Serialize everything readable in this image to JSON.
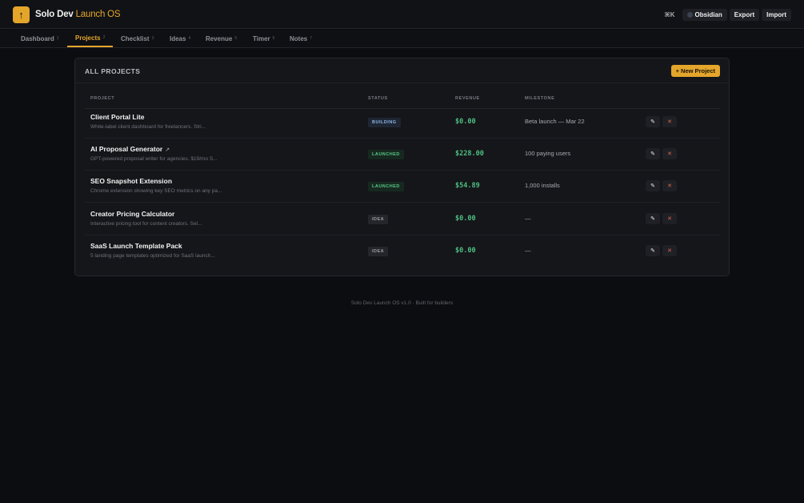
{
  "header": {
    "logo_glyph": "↑",
    "brand_primary": "Solo Dev",
    "brand_accent": "Launch OS",
    "shortcut": "⌘K",
    "theme_button": "Obsidian",
    "export_button": "Export",
    "import_button": "Import"
  },
  "nav": {
    "tabs": [
      {
        "label": "Dashboard",
        "key": "1"
      },
      {
        "label": "Projects",
        "key": "2"
      },
      {
        "label": "Checklist",
        "key": "3"
      },
      {
        "label": "Ideas",
        "key": "4"
      },
      {
        "label": "Revenue",
        "key": "5"
      },
      {
        "label": "Timer",
        "key": "6"
      },
      {
        "label": "Notes",
        "key": "7"
      }
    ],
    "active": "Projects"
  },
  "panel": {
    "title": "ALL PROJECTS",
    "new_button": "+ New Project",
    "columns": [
      "PROJECT",
      "STATUS",
      "REVENUE",
      "MILESTONE"
    ],
    "rows": [
      {
        "name": "Client Portal Lite",
        "external": "",
        "desc": "White-label client dashboard for freelancers. Stri...",
        "status": "BUILDING",
        "revenue": "$0.00",
        "milestone": "Beta launch — Mar 22"
      },
      {
        "name": "AI Proposal Generator",
        "external": "↗",
        "desc": "GPT-powered proposal writer for agencies. $19/mo S...",
        "status": "LAUNCHED",
        "revenue": "$228.00",
        "milestone": "100 paying users"
      },
      {
        "name": "SEO Snapshot Extension",
        "external": "",
        "desc": "Chrome extension showing key SEO metrics on any pa...",
        "status": "LAUNCHED",
        "revenue": "$54.89",
        "milestone": "1,000 installs"
      },
      {
        "name": "Creator Pricing Calculator",
        "external": "",
        "desc": "Interactive pricing tool for content creators. Sel...",
        "status": "IDEA",
        "revenue": "$0.00",
        "milestone": "—"
      },
      {
        "name": "SaaS Launch Template Pack",
        "external": "",
        "desc": "5 landing page templates optimized for SaaS launch...",
        "status": "IDEA",
        "revenue": "$0.00",
        "milestone": "—"
      }
    ],
    "edit_glyph": "✎",
    "delete_glyph": "✕"
  },
  "footer": {
    "text": "Solo Dev Launch OS v1.0 · Built for builders"
  },
  "colors": {
    "accent": "#e4a52b",
    "success": "#4fbf80",
    "danger": "#e0694f",
    "background": "#0c0d10"
  }
}
